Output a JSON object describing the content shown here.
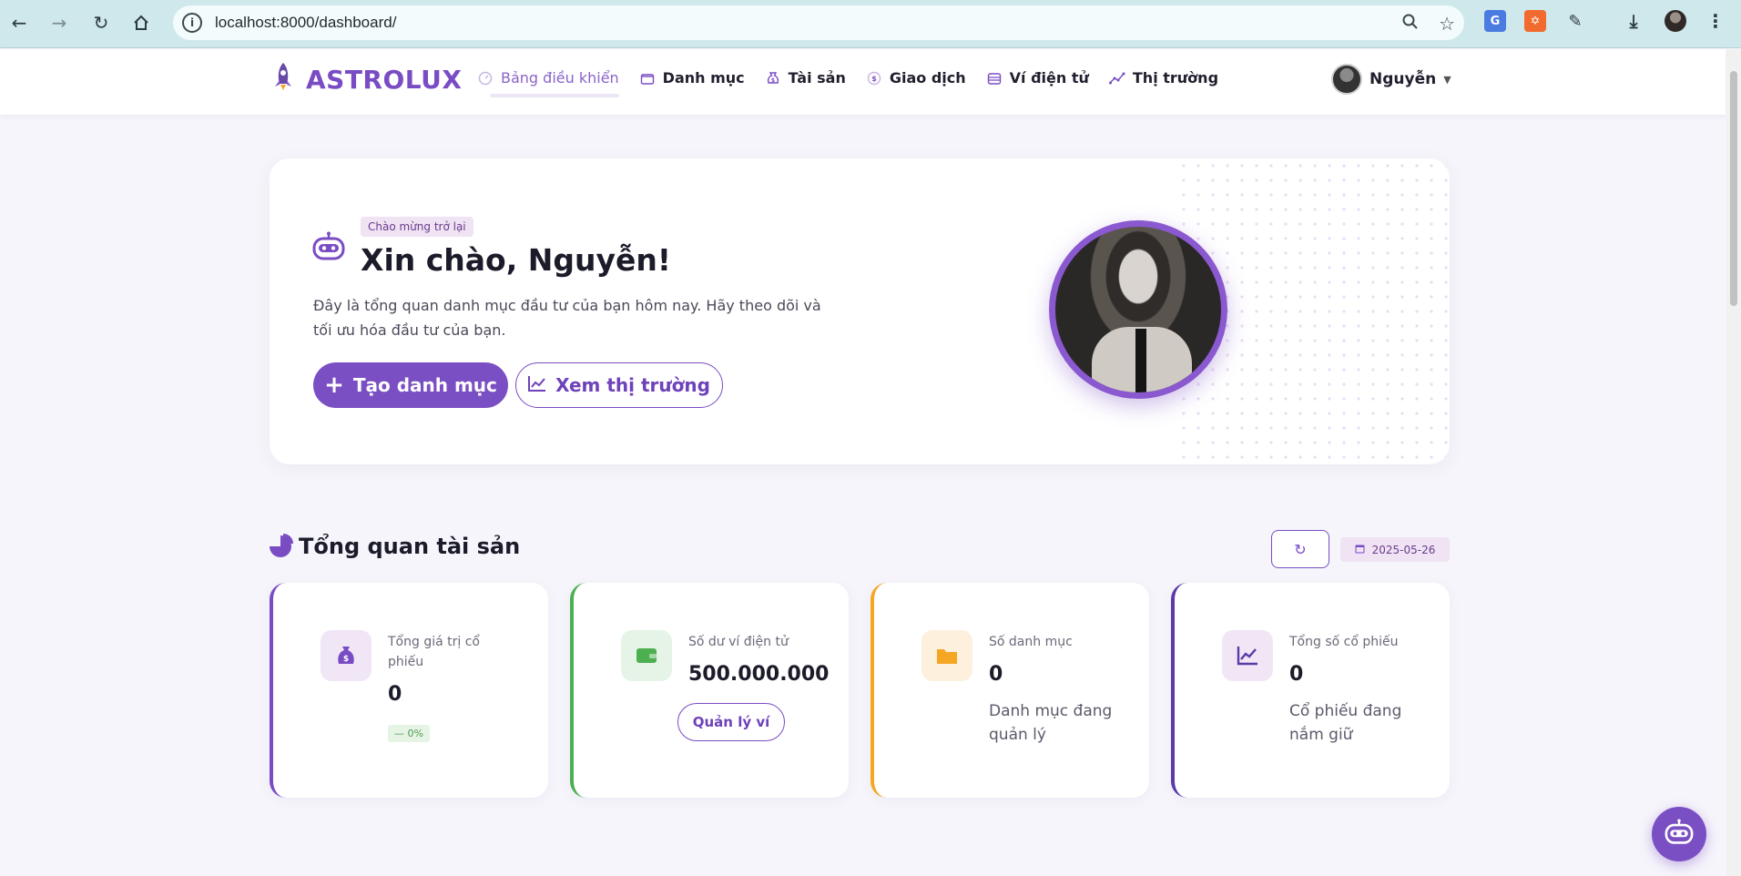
{
  "browser": {
    "url": "localhost:8000/dashboard/"
  },
  "brand": {
    "name": "ASTROLUX"
  },
  "nav": {
    "items": [
      {
        "label": "Bảng điều khiển",
        "icon": "dashboard-icon",
        "active": true
      },
      {
        "label": "Danh mục",
        "icon": "folder-icon",
        "active": false
      },
      {
        "label": "Tài sản",
        "icon": "money-bag-icon",
        "active": false
      },
      {
        "label": "Giao dịch",
        "icon": "transaction-icon",
        "active": false
      },
      {
        "label": "Ví điện tử",
        "icon": "wallet-icon",
        "active": false
      },
      {
        "label": "Thị trường",
        "icon": "market-icon",
        "active": false
      }
    ],
    "user_name": "Nguyễn"
  },
  "welcome": {
    "badge": "Chào mừng trở lại",
    "greeting": "Xin chào, Nguyễn!",
    "intro": "Đây là tổng quan danh mục đầu tư của bạn hôm nay. Hãy theo dõi và tối ưu hóa đầu tư của bạn.",
    "create_button": "Tạo danh mục",
    "market_button": "Xem thị trường"
  },
  "overview": {
    "title": "Tổng quan tài sản",
    "date": "2025-05-26",
    "cards": [
      {
        "label": "Tổng giá trị cổ phiếu",
        "value": "0",
        "change": "0%",
        "accent": "#7a4cc4"
      },
      {
        "label": "Số dư ví điện tử",
        "value": "500.000.000",
        "button": "Quản lý ví",
        "accent": "#4caf50"
      },
      {
        "label": "Số danh mục",
        "value": "0",
        "description": "Danh mục đang quản lý",
        "accent": "#f5a623"
      },
      {
        "label": "Tổng số cổ phiếu",
        "value": "0",
        "description": "Cổ phiếu đang nắm giữ",
        "accent": "#5b3aa8"
      }
    ]
  },
  "colors": {
    "primary": "#7b4fc4",
    "background": "#f6f5fb"
  }
}
